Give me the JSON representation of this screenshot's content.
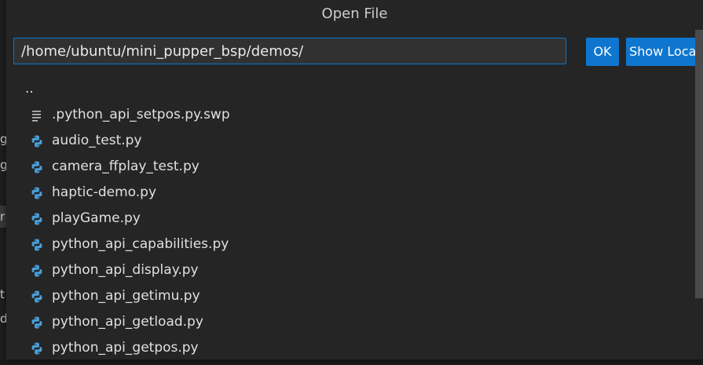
{
  "dialog": {
    "title": "Open File",
    "path_value": "/home/ubuntu/mini_pupper_bsp/demos/",
    "ok_label": "OK",
    "show_local_label": "Show Local"
  },
  "background_fragments": [
    "g",
    "g",
    "r",
    "t",
    "d"
  ],
  "files": [
    {
      "label": "..",
      "icon": "none"
    },
    {
      "label": ".python_api_setpos.py.swp",
      "icon": "text-file-icon"
    },
    {
      "label": "audio_test.py",
      "icon": "python-icon"
    },
    {
      "label": "camera_ffplay_test.py",
      "icon": "python-icon"
    },
    {
      "label": "haptic-demo.py",
      "icon": "python-icon"
    },
    {
      "label": "playGame.py",
      "icon": "python-icon"
    },
    {
      "label": "python_api_capabilities.py",
      "icon": "python-icon"
    },
    {
      "label": "python_api_display.py",
      "icon": "python-icon"
    },
    {
      "label": "python_api_getimu.py",
      "icon": "python-icon"
    },
    {
      "label": "python_api_getload.py",
      "icon": "python-icon"
    },
    {
      "label": "python_api_getpos.py",
      "icon": "python-icon"
    }
  ],
  "colors": {
    "accent": "#0e76cf",
    "python_icon": "#4a9fd8"
  }
}
